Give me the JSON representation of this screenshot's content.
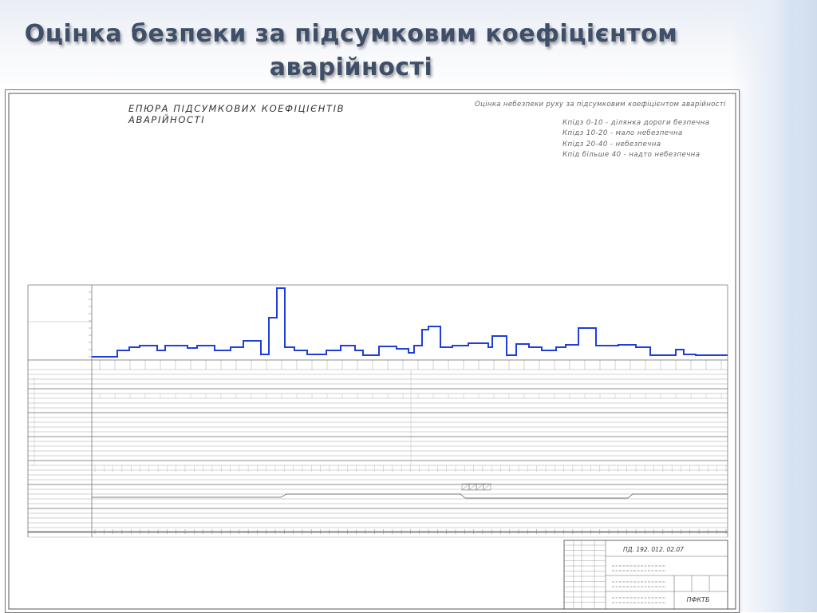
{
  "slide": {
    "title_line1": "Оцінка безпеки за підсумковим коефіцієнтом",
    "title_line2": "аварійності"
  },
  "drawing": {
    "main_title": "ЕПЮРА ПІДСУМКОВИХ КОЕФІЦІЄНТІВ АВАРІЙНОСТІ",
    "note_title": "Оцінка небезпеки руху за підсумковим коефіцієнтом аварійності",
    "note_lines": [
      "Кпідз 0-10 - ділянка дороги безпечна",
      "Кпідз 10-20 - мало небезпечна",
      "Кпідз 20-40 - небезпечна",
      "Кпід більше 40 - надто небезпечна"
    ],
    "stamp_code": "ПД. 192. 012. 02.07",
    "stamp_org": "ПФКТБ"
  }
}
